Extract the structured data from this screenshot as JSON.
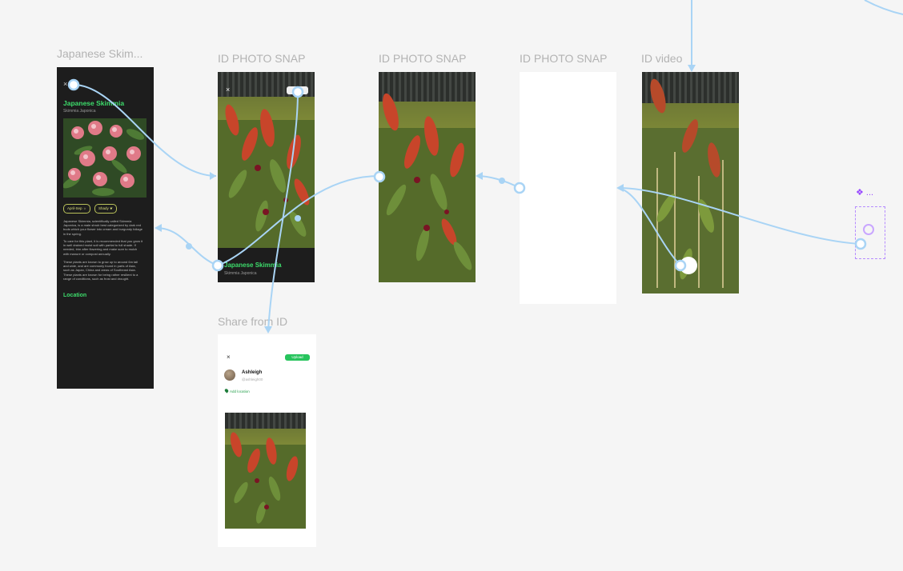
{
  "frames": {
    "detail": {
      "title": "Japanese Skim...",
      "close": "×",
      "plant_name": "Japanese Skimmia",
      "latin_name": "Skimmia Japonica",
      "chip_season": "April-Sep",
      "chip_light": "Shady",
      "para1": "Japanese Skimmia, scientifically called Skimmia Japonica, is a male shrub best categorized by dark red buds which your flower into cream and burgundy foliage in the spring.",
      "para2": "To care for this plant, it is recommended that you grow it in well drained moist soil with partial to full shade. If needed, trim after flowering and make sure to mulch with manure or compost annually.",
      "para3": "These plants are known to grow up to around 6m tall and wide, and are commonly found in parts of Asia, such as Japan, China and areas of Southeast Asia. These plants are known for being rather resilient to a range of conditions, such as frost and drought.",
      "location": "Location"
    },
    "snap1": {
      "title": "ID PHOTO SNAP",
      "close": "×",
      "plant_name": "Japanese Skimmia",
      "latin_name": "Skimmia Japonica"
    },
    "snap2": {
      "title": "ID PHOTO SNAP"
    },
    "snap3": {
      "title": "ID PHOTO SNAP"
    },
    "video": {
      "title": "ID video"
    },
    "share": {
      "title": "Share from ID",
      "close": "×",
      "upload": "Upload",
      "username": "Ashleigh",
      "handle": "@ashleigh00",
      "add_location": "Add location"
    },
    "component": {
      "label": "❖ ..."
    }
  },
  "colors": {
    "canvas": "#f5f5f5",
    "wire": "#a9d4f5",
    "accent_green": "#3ddc6b",
    "component_purple": "#9747ff"
  }
}
